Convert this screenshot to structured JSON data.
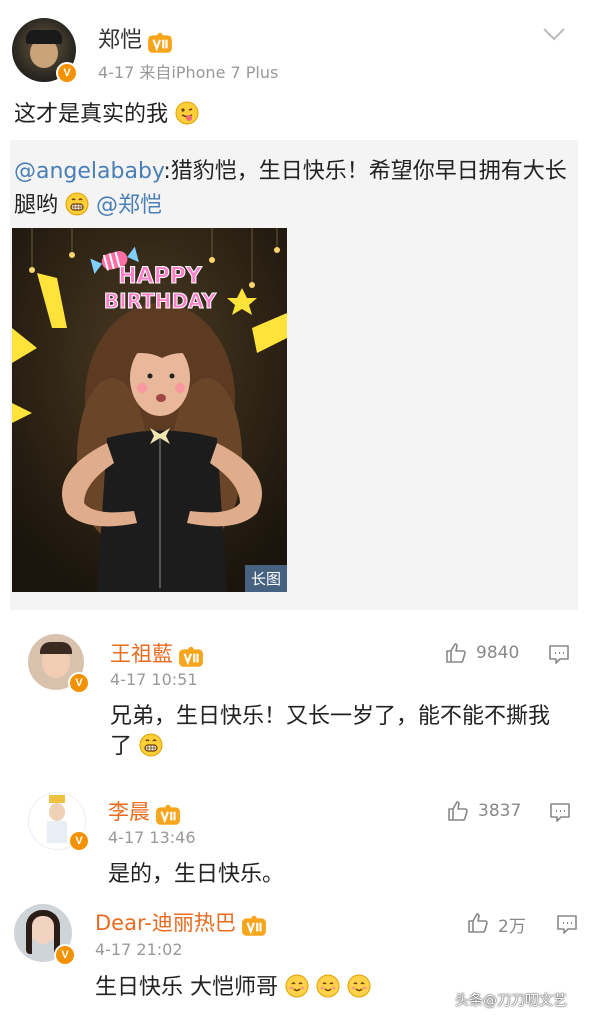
{
  "post": {
    "author": "郑恺",
    "meta": "4-17  来自iPhone 7 Plus",
    "text": "这才是真实的我",
    "repost": {
      "mention": "@angelababy",
      "text": ":猎豹恺，生日快乐！希望你早日拥有大长腿哟",
      "trailing_mention": "@郑恺",
      "image_badge": "长图",
      "image_caption": "HAPPY BIRTHDAY"
    }
  },
  "comments": [
    {
      "author": "王祖藍",
      "time": "4-17 10:51",
      "likes": "9840",
      "text": "兄弟，生日快乐！又长一岁了，能不能不撕我了"
    },
    {
      "author": "李晨",
      "time": "4-17 13:46",
      "likes": "3837",
      "text": "是的，生日快乐。"
    },
    {
      "author": "Dear-迪丽热巴",
      "time": "4-17 21:02",
      "likes": "2万",
      "text": "生日快乐 大恺师哥"
    }
  ],
  "watermark": "头条@刀刀叨文艺",
  "icons": {
    "vip": "vip-crown-icon",
    "verified": "verified-v-icon",
    "like": "thumbs-up-icon",
    "comment": "comment-bubble-icon",
    "chevron": "chevron-down-icon"
  },
  "colors": {
    "name": "#e86b20",
    "link": "#4a7fb5",
    "badge": "#f29200"
  }
}
